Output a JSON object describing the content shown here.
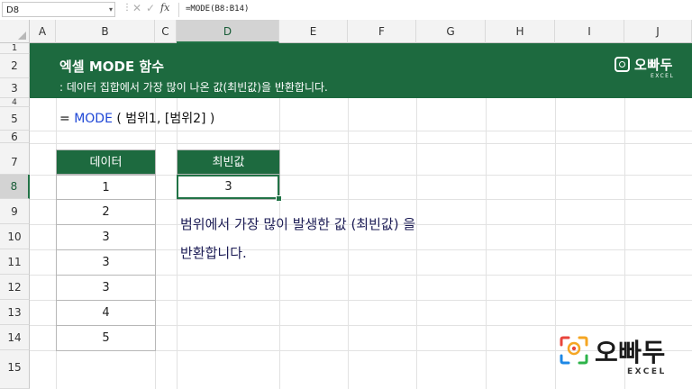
{
  "formula_bar": {
    "name_box": "D8",
    "fx_label": "fx",
    "formula": "=MODE(B8:B14)"
  },
  "columns": [
    "A",
    "B",
    "C",
    "D",
    "E",
    "F",
    "G",
    "H",
    "I",
    "J"
  ],
  "selected_column": "D",
  "rows": [
    "1",
    "2",
    "3",
    "4",
    "5",
    "6",
    "7",
    "8",
    "9",
    "10",
    "11",
    "12",
    "13",
    "14",
    "15"
  ],
  "selected_row": "8",
  "banner": {
    "title": "엑셀 MODE 함수",
    "subtitle": ": 데이터 집합에서 가장 많이 나온 값(최빈값)을 반환합니다.",
    "logo_text": "오빠두",
    "logo_sub": "EXCEL",
    "color": "#1d6a3f"
  },
  "syntax": {
    "prefix": "= ",
    "function": "MODE",
    "args": " ( 범위1, [범위2] )"
  },
  "data_table": {
    "header": "데이터",
    "values": [
      "1",
      "2",
      "3",
      "3",
      "3",
      "4",
      "5"
    ]
  },
  "result_table": {
    "header": "최빈값",
    "value": "3"
  },
  "description": {
    "line1": "범위에서 가장 많이 발생한 값 (최빈값) 을",
    "line2": "반환합니다."
  },
  "watermark": {
    "text": "오빠두",
    "sub": "EXCEL"
  }
}
